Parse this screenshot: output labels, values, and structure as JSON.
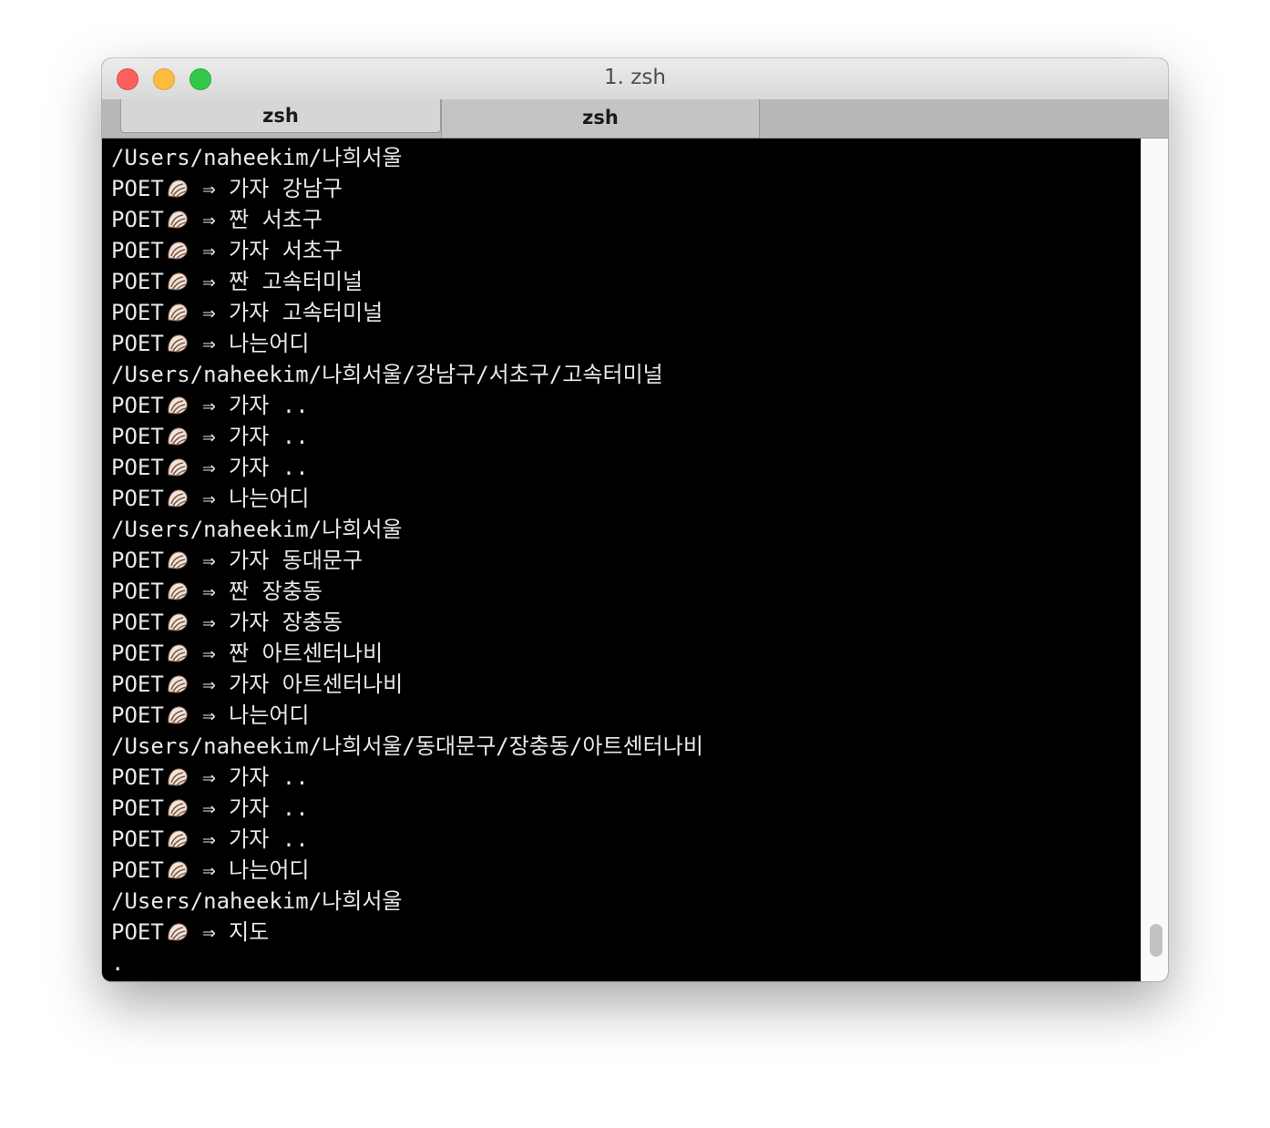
{
  "window": {
    "title": "1. zsh"
  },
  "tabs": [
    {
      "label": "zsh",
      "active": true
    },
    {
      "label": "zsh",
      "active": false
    }
  ],
  "prompt": {
    "name": "POET",
    "icon": "spiral-shell-icon",
    "arrow": " ⇒ "
  },
  "terminal": {
    "lines": [
      {
        "type": "path",
        "text": "/Users/naheekim/나희서울"
      },
      {
        "type": "prompt",
        "text": "가자 강남구"
      },
      {
        "type": "prompt",
        "text": "짠 서초구"
      },
      {
        "type": "prompt",
        "text": "가자 서초구"
      },
      {
        "type": "prompt",
        "text": "짠 고속터미널"
      },
      {
        "type": "prompt",
        "text": "가자 고속터미널"
      },
      {
        "type": "prompt",
        "text": "나는어디"
      },
      {
        "type": "path",
        "text": "/Users/naheekim/나희서울/강남구/서초구/고속터미널"
      },
      {
        "type": "prompt",
        "text": "가자 .."
      },
      {
        "type": "prompt",
        "text": "가자 .."
      },
      {
        "type": "prompt",
        "text": "가자 .."
      },
      {
        "type": "prompt",
        "text": "나는어디"
      },
      {
        "type": "path",
        "text": "/Users/naheekim/나희서울"
      },
      {
        "type": "prompt",
        "text": "가자 동대문구"
      },
      {
        "type": "prompt",
        "text": "짠 장충동"
      },
      {
        "type": "prompt",
        "text": "가자 장충동"
      },
      {
        "type": "prompt",
        "text": "짠 아트센터나비"
      },
      {
        "type": "prompt",
        "text": "가자 아트센터나비"
      },
      {
        "type": "prompt",
        "text": "나는어디"
      },
      {
        "type": "path",
        "text": "/Users/naheekim/나희서울/동대문구/장충동/아트센터나비"
      },
      {
        "type": "prompt",
        "text": "가자 .."
      },
      {
        "type": "prompt",
        "text": "가자 .."
      },
      {
        "type": "prompt",
        "text": "가자 .."
      },
      {
        "type": "prompt",
        "text": "나는어디"
      },
      {
        "type": "path",
        "text": "/Users/naheekim/나희서울"
      },
      {
        "type": "prompt",
        "text": "지도"
      },
      {
        "type": "path",
        "text": "."
      }
    ]
  },
  "colors": {
    "terminal_bg": "#000000",
    "terminal_fg": "#e8e8e8",
    "close": "#fc605c",
    "minimize": "#fdbc40",
    "maximize": "#34c84a"
  }
}
